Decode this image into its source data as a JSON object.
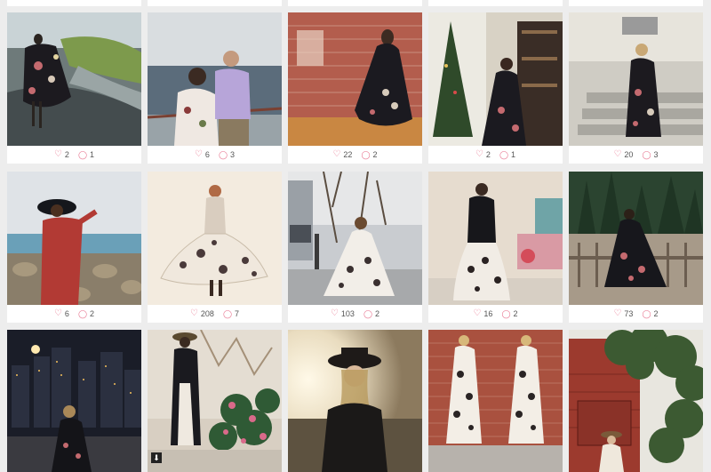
{
  "gallery": {
    "posts": [
      {
        "likes": "2",
        "comments": "1",
        "scene": "rain path, woman in black floral maxi dress"
      },
      {
        "likes": "6",
        "comments": "3",
        "scene": "couple by waterfront"
      },
      {
        "likes": "22",
        "comments": "2",
        "scene": "brick wall, twirling dress"
      },
      {
        "likes": "2",
        "comments": "1",
        "scene": "christmas tree and bookshelf"
      },
      {
        "likes": "20",
        "comments": "3",
        "scene": "steps outside house"
      },
      {
        "likes": "6",
        "comments": "2",
        "scene": "red dress, black hat, lake"
      },
      {
        "likes": "208",
        "comments": "7",
        "scene": "white floral dress twirl"
      },
      {
        "likes": "103",
        "comments": "2",
        "scene": "city street"
      },
      {
        "likes": "16",
        "comments": "2",
        "scene": "mirror selfie"
      },
      {
        "likes": "73",
        "comments": "2",
        "scene": "deck with pine forest"
      },
      {
        "scene": "city at night"
      },
      {
        "scene": "woman with hat by flowers"
      },
      {
        "scene": "black hat portrait sunset"
      },
      {
        "scene": "twin photos against brick"
      },
      {
        "scene": "red barn with ivy"
      }
    ]
  },
  "colors": {
    "accent": "#e8748f",
    "background": "#ededed",
    "card": "#ffffff"
  },
  "icons": {
    "like": "heart-icon",
    "comment": "comment-icon",
    "media": "download-icon"
  }
}
